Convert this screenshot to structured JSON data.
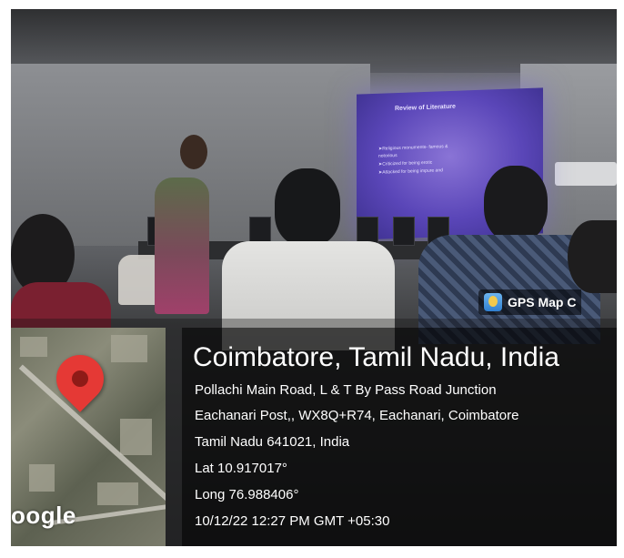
{
  "gps_badge": {
    "text": "GPS Map C",
    "icon": "gps-map-camera-icon"
  },
  "map": {
    "logo_text": "oogle",
    "pin": "location-pin-icon"
  },
  "location": {
    "title": "Coimbatore, Tamil Nadu, India",
    "address_line1": "Pollachi Main Road, L & T By Pass Road Junction",
    "address_line2": "Eachanari Post,, WX8Q+R74, Eachanari, Coimbatore",
    "address_line3": "Tamil Nadu 641021, India",
    "lat": "Lat 10.917017°",
    "long": "Long 76.988406°",
    "timestamp": "10/12/22 12:27 PM GMT +05:30"
  },
  "slide": {
    "title": "Review of Literature",
    "bullets": [
      "➤Religious monuments- famous &",
      "notorious",
      "➤Criticized for being erotic",
      "➤Attacked for being impure and"
    ]
  },
  "colors": {
    "pin": "#e53935",
    "overlay": "rgba(0,0,0,0.55)",
    "screen": "#5a46b8"
  }
}
